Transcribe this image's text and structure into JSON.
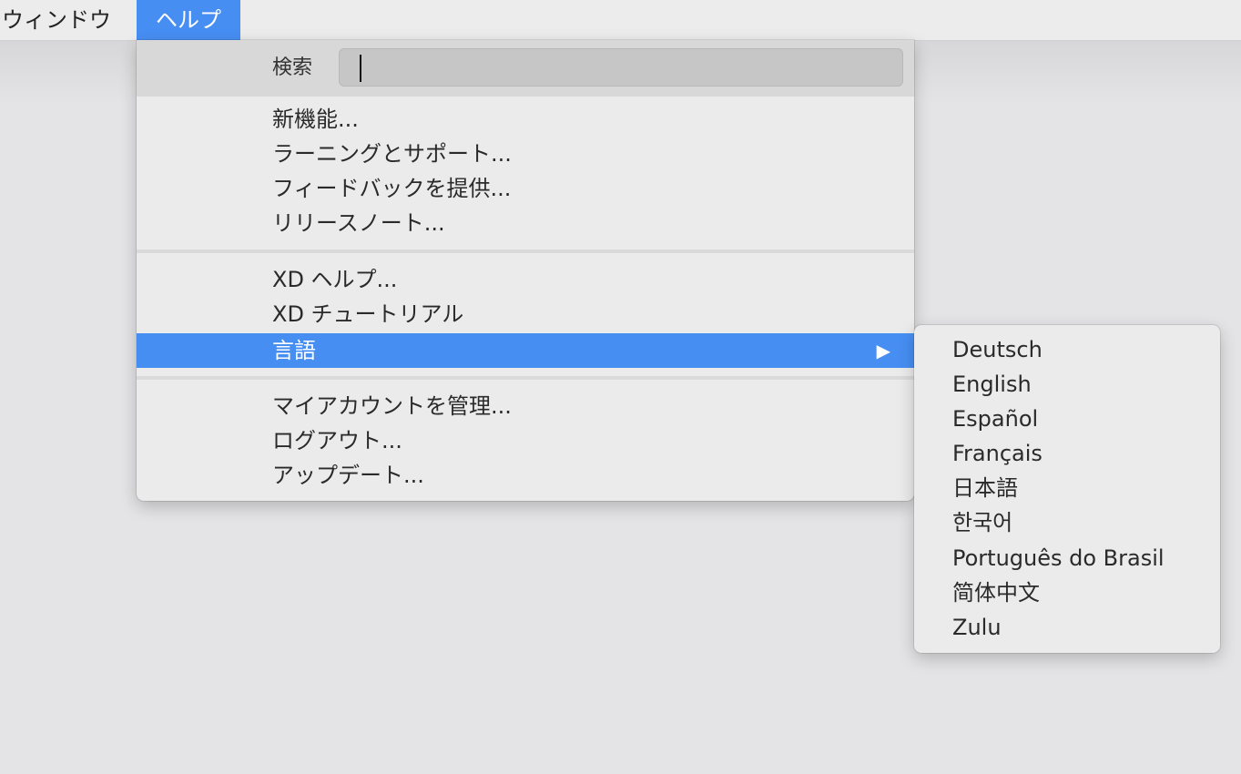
{
  "menubar": {
    "items": [
      {
        "label": "ウィンドウ"
      },
      {
        "label": "ヘルプ",
        "active": true
      }
    ]
  },
  "help_menu": {
    "search": {
      "label": "検索",
      "value": ""
    },
    "groups": [
      [
        "新機能...",
        "ラーニングとサポート...",
        "フィードバックを提供...",
        "リリースノート..."
      ],
      [
        "XD ヘルプ...",
        "XD チュートリアル",
        "言語"
      ],
      [
        "マイアカウントを管理...",
        "ログアウト...",
        "アップデート..."
      ]
    ],
    "highlighted_item": "言語",
    "submenu_arrow": "▶"
  },
  "language_submenu": {
    "items": [
      "Deutsch",
      "English",
      "Español",
      "Français",
      "日本語",
      "한국어",
      "Português do Brasil",
      "简体中文",
      "Zulu"
    ]
  },
  "colors": {
    "accent": "#478ef3",
    "menu_background": "#ebebeb",
    "desktop_background": "#e4e4e6"
  }
}
